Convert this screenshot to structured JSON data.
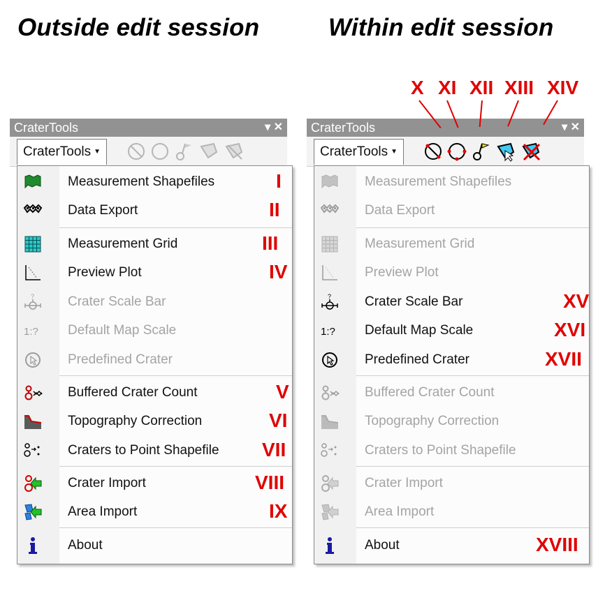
{
  "headings": {
    "left": "Outside edit session",
    "right": "Within edit session"
  },
  "panel": {
    "title": "CraterTools",
    "dropdown_label": "CraterTools"
  },
  "left_menu": [
    {
      "label": "Measurement Shapefiles",
      "numeral": "I",
      "enabled": true,
      "icon": "flag-icon"
    },
    {
      "label": "Data Export",
      "numeral": "II",
      "enabled": true,
      "icon": "checkered-flag-icon"
    },
    {
      "label": "Measurement Grid",
      "numeral": "III",
      "enabled": true,
      "icon": "grid-icon"
    },
    {
      "label": "Preview Plot",
      "numeral": "IV",
      "enabled": true,
      "icon": "plot-icon"
    },
    {
      "label": "Crater Scale Bar",
      "numeral": "",
      "enabled": false,
      "icon": "scale-bar-icon"
    },
    {
      "label": "Default Map Scale",
      "numeral": "",
      "enabled": false,
      "icon": "map-scale-icon"
    },
    {
      "label": "Predefined Crater",
      "numeral": "",
      "enabled": false,
      "icon": "predefined-crater-icon"
    },
    {
      "label": "Buffered Crater Count",
      "numeral": "V",
      "enabled": true,
      "icon": "buffered-count-icon"
    },
    {
      "label": "Topography Correction",
      "numeral": "VI",
      "enabled": true,
      "icon": "topography-icon"
    },
    {
      "label": "Craters to Point Shapefile",
      "numeral": "VII",
      "enabled": true,
      "icon": "points-icon"
    },
    {
      "label": "Crater Import",
      "numeral": "VIII",
      "enabled": true,
      "icon": "crater-import-icon"
    },
    {
      "label": "Area Import",
      "numeral": "IX",
      "enabled": true,
      "icon": "area-import-icon"
    },
    {
      "label": "About",
      "numeral": "",
      "enabled": true,
      "icon": "info-icon"
    }
  ],
  "right_menu": [
    {
      "label": "Measurement Shapefiles",
      "numeral": "",
      "enabled": false,
      "icon": "flag-icon"
    },
    {
      "label": "Data Export",
      "numeral": "",
      "enabled": false,
      "icon": "checkered-flag-icon"
    },
    {
      "label": "Measurement Grid",
      "numeral": "",
      "enabled": false,
      "icon": "grid-icon"
    },
    {
      "label": "Preview Plot",
      "numeral": "",
      "enabled": false,
      "icon": "plot-icon"
    },
    {
      "label": "Crater Scale Bar",
      "numeral": "XV",
      "enabled": true,
      "icon": "scale-bar-icon"
    },
    {
      "label": "Default Map Scale",
      "numeral": "XVI",
      "enabled": true,
      "icon": "map-scale-icon"
    },
    {
      "label": "Predefined Crater",
      "numeral": "XVII",
      "enabled": true,
      "icon": "predefined-crater-icon"
    },
    {
      "label": "Buffered Crater Count",
      "numeral": "",
      "enabled": false,
      "icon": "buffered-count-icon"
    },
    {
      "label": "Topography Correction",
      "numeral": "",
      "enabled": false,
      "icon": "topography-icon"
    },
    {
      "label": "Craters to Point Shapefile",
      "numeral": "",
      "enabled": false,
      "icon": "points-icon"
    },
    {
      "label": "Crater Import",
      "numeral": "",
      "enabled": false,
      "icon": "crater-import-icon"
    },
    {
      "label": "Area Import",
      "numeral": "",
      "enabled": false,
      "icon": "area-import-icon"
    },
    {
      "label": "About",
      "numeral": "XVIII",
      "enabled": true,
      "icon": "info-icon"
    }
  ],
  "toolbar_numerals": [
    "X",
    "XI",
    "XII",
    "XIII",
    "XIV"
  ],
  "toolbar_icons": [
    "circle-slash-tool-icon",
    "circle-tool-icon",
    "flag-point-tool-icon",
    "polygon-tool-icon",
    "polygon-delete-tool-icon"
  ],
  "colors": {
    "accent_red": "#e00000",
    "titlebar": "#929292"
  }
}
